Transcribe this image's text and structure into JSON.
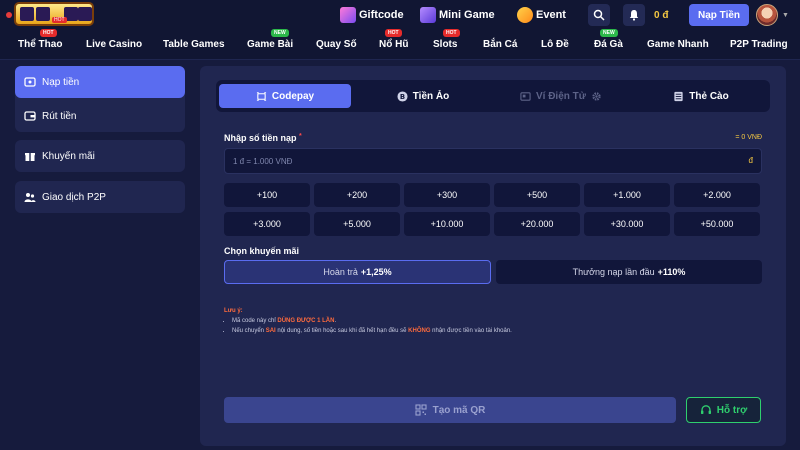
{
  "topbar": {
    "promos": [
      {
        "label": "Giftcode",
        "icon": "gift-icon"
      },
      {
        "label": "Mini Game",
        "icon": "minigame-icon"
      },
      {
        "label": "Event",
        "icon": "event-icon"
      }
    ],
    "balance": "0 đ",
    "deposit_label": "Nạp Tiền",
    "logo_badge": "HOT"
  },
  "nav": {
    "items": [
      {
        "label": "Thể Thao",
        "badge": "HOT"
      },
      {
        "label": "Live Casino",
        "badge": ""
      },
      {
        "label": "Table Games",
        "badge": ""
      },
      {
        "label": "Game Bài",
        "badge": "NEW"
      },
      {
        "label": "Quay Số",
        "badge": ""
      },
      {
        "label": "Nổ Hũ",
        "badge": "HOT"
      },
      {
        "label": "Slots",
        "badge": "HOT"
      },
      {
        "label": "Bắn Cá",
        "badge": ""
      },
      {
        "label": "Lô Đề",
        "badge": ""
      },
      {
        "label": "Đá Gà",
        "badge": "NEW"
      },
      {
        "label": "Game Nhanh",
        "badge": ""
      },
      {
        "label": "P2P Trading",
        "badge": ""
      }
    ]
  },
  "sidebar": {
    "items": [
      {
        "label": "Nạp tiền",
        "icon": "wallet-in-icon"
      },
      {
        "label": "Rút tiền",
        "icon": "wallet-out-icon"
      },
      {
        "label": "Khuyến mãi",
        "icon": "gift-icon"
      },
      {
        "label": "Giao dịch P2P",
        "icon": "users-icon"
      }
    ]
  },
  "payment": {
    "tabs": [
      {
        "label": "Codepay",
        "state": "active"
      },
      {
        "label": "Tiền Ảo",
        "state": "normal"
      },
      {
        "label": "Ví Điện Tử",
        "state": "disabled"
      },
      {
        "label": "Thẻ Cào",
        "state": "normal"
      }
    ],
    "amount_label": "Nhập số tiền nạp",
    "required_mark": "*",
    "rate_text": "= 0 VNĐ",
    "amount_placeholder": "1 đ = 1.000 VNĐ",
    "currency_symbol": "đ",
    "quick_amounts": [
      "+100",
      "+200",
      "+300",
      "+500",
      "+1.000",
      "+2.000",
      "+3.000",
      "+5.000",
      "+10.000",
      "+20.000",
      "+30.000",
      "+50.000"
    ],
    "promo_label": "Chọn khuyến mãi",
    "promo_options": [
      {
        "text": "Hoàn trả",
        "value": "+1,25%",
        "selected": true
      },
      {
        "text": "Thưởng nạp lần đầu",
        "value": "+110%",
        "selected": false
      }
    ],
    "note": {
      "title": "Lưu ý:",
      "line1_pre": "Mã code này chỉ ",
      "line1_hl": "DÙNG ĐƯỢC 1 LẦN",
      "line1_post": ".",
      "line2_pre": "Nếu chuyển ",
      "line2_hl1": "SAI",
      "line2_mid": " nội dung, số tiền hoặc sau khi đã hết hạn đều sẽ ",
      "line2_hl2": "KHÔNG",
      "line2_post": " nhận được tiền vào tài khoản."
    },
    "qr_button": "Tạo mã QR",
    "support_button": "Hỗ trợ"
  },
  "colors": {
    "accent": "#5a6cf0",
    "bg": "#161b3d",
    "panel": "#202650",
    "warning": "#ff6b3d",
    "gold": "#f5c842",
    "support": "#2fcf6e"
  }
}
